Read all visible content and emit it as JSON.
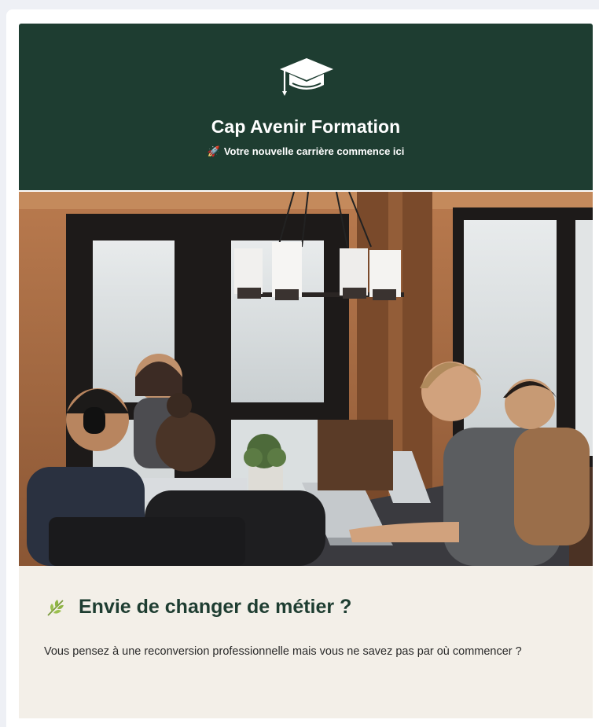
{
  "header": {
    "brand_name": "Cap Avenir Formation",
    "tagline": "Votre nouvelle carrière commence ici",
    "tagline_emoji": "🚀",
    "icon": "graduation-cap-icon",
    "background_color": "#1e3d31"
  },
  "hero": {
    "image_subject": "coworking-meeting-photo"
  },
  "section": {
    "icon": "leaf-icon",
    "title": "Envie de changer de métier ?",
    "body": "Vous pensez à une reconversion professionnelle mais vous ne savez pas par où commencer ?",
    "background_color": "#f3efe8",
    "title_color": "#1e3d31"
  }
}
